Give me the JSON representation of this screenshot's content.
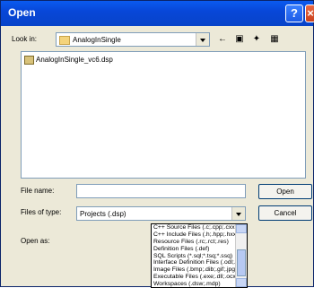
{
  "window": {
    "title": "Open"
  },
  "lookin": {
    "label": "Look in:",
    "value": "AnalogInSingle"
  },
  "files": [
    "AnalogInSingle_vc6.dsp"
  ],
  "filename": {
    "label": "File name:",
    "value": ""
  },
  "filetype": {
    "label": "Files of type:",
    "value": "Projects (.dsp)"
  },
  "openas": {
    "label": "Open as:"
  },
  "buttons": {
    "open": "Open",
    "cancel": "Cancel"
  },
  "filetype_options": [
    "C++ Source Files (.c;.cpp;.cxx;.tli)",
    "C++ Include Files (.h;.hpp;.hxx;.inl;.tlh)",
    "Resource Files (.rc;.rct;.res)",
    "Definition Files (.def)",
    "SQL Scripts (*.sql;*.tsq;*.ssq)",
    "Interface Definition Files (.odl;.idl)",
    "Image Files (.bmp;.dib;.gif;.jpg;.jpe*;.ico;.cur)",
    "Executable Files (.exe;.dll;.ocx)",
    "Workspaces (.dsw;.mdp)",
    "Projects (.dsp)"
  ],
  "selected_option": 9
}
